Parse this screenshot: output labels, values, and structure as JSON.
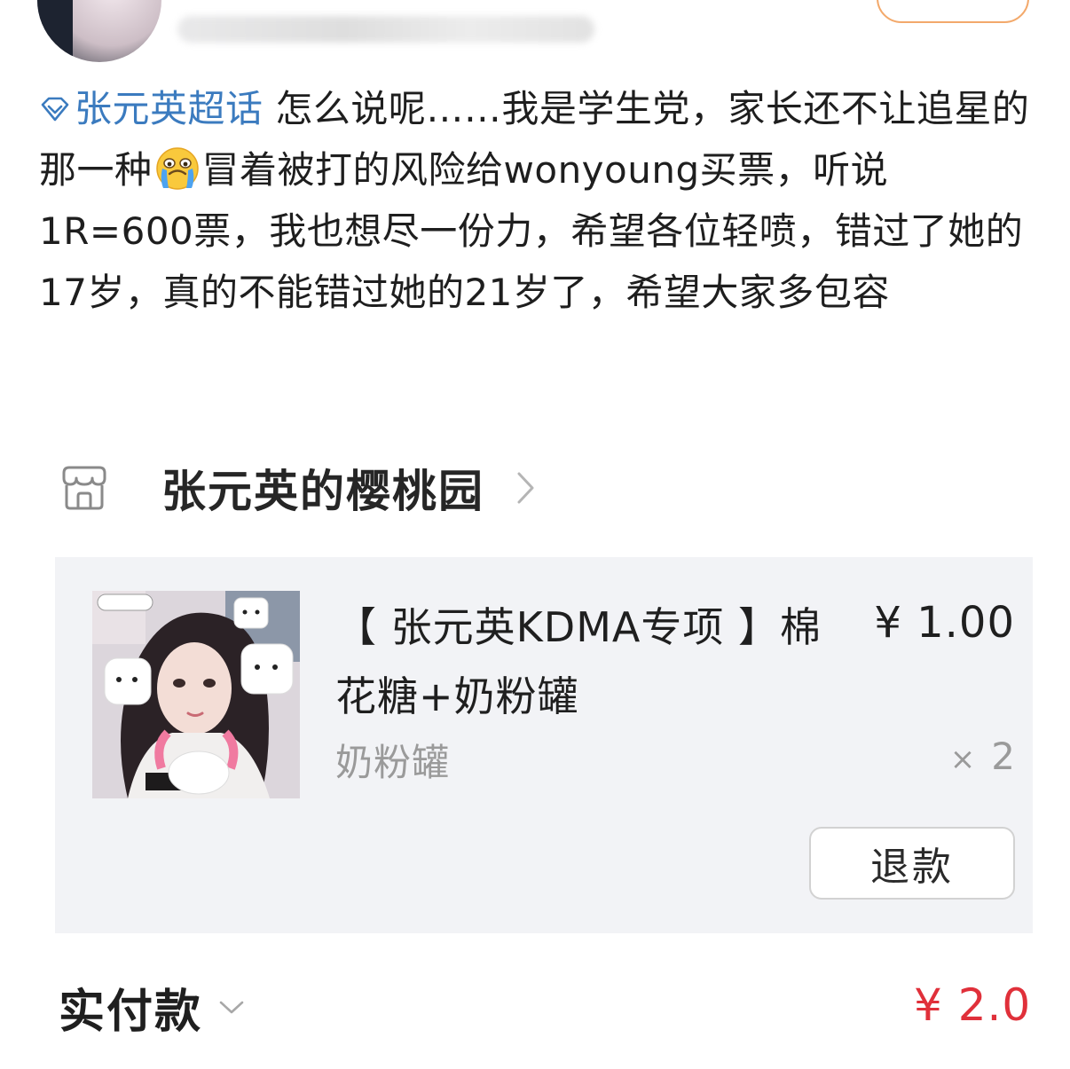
{
  "post": {
    "topic_label": "张元英超话",
    "text_part1": " 怎么说呢……我是学生党，家长还不让追星的那一种",
    "text_part2": "冒着被打的风险给wonyoung买票，听说1R=600票，我也想尽一份力，希望各位轻喷，错过了她的17岁，真的不能错过她的21岁了，希望大家多包容",
    "emoji_name": "loudly-crying-face"
  },
  "shop": {
    "name": "张元英的樱桃园"
  },
  "order": {
    "product_title": "【 张元英KDMA专项 】棉花糖+奶粉罐",
    "price": "¥ 1.00",
    "variant": "奶粉罐",
    "quantity_symbol": "×",
    "quantity": "2",
    "refund_label": "退款"
  },
  "total": {
    "label": "实付款",
    "value": "¥ 2.00"
  },
  "colors": {
    "topic_link": "#3b7bbf",
    "price_accent": "#e0303a",
    "card_background": "#f2f3f6",
    "follow_border": "#f3a96b"
  }
}
